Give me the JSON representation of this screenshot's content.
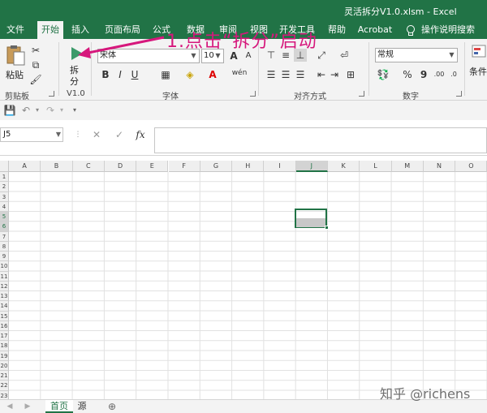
{
  "window": {
    "title": "灵活拆分V1.0.xlsm  -  Excel"
  },
  "tabs": [
    {
      "label": "文件"
    },
    {
      "label": "开始"
    },
    {
      "label": "插入"
    },
    {
      "label": "页面布局"
    },
    {
      "label": "公式"
    },
    {
      "label": "数据"
    },
    {
      "label": "审阅"
    },
    {
      "label": "视图"
    },
    {
      "label": "开发工具"
    },
    {
      "label": "帮助"
    },
    {
      "label": "Acrobat"
    }
  ],
  "tell_me": {
    "label": "操作说明搜索"
  },
  "ribbon": {
    "clipboard": {
      "paste_label": "粘贴",
      "group_label": "剪贴板"
    },
    "split": {
      "button_label_1": "拆",
      "button_label_2": "分",
      "group_label": "V1.0"
    },
    "font": {
      "family": "宋体",
      "size": "10",
      "grow": "A",
      "shrink": "A",
      "bold": "B",
      "italic": "I",
      "underline": "U",
      "font_color_letter": "A",
      "phonetic": "wén",
      "group_label": "字体"
    },
    "alignment": {
      "group_label": "对齐方式"
    },
    "number": {
      "format": "常规",
      "percent": "%",
      "comma": "9",
      "increase_decimal": ".00",
      "decrease_decimal": ".0",
      "group_label": "数字"
    },
    "styles": {
      "conditional_label": "条件"
    }
  },
  "formula_bar": {
    "name_box": "J5",
    "cancel": "✕",
    "enter": "✓",
    "fx": "fx",
    "value": ""
  },
  "grid": {
    "columns": [
      "A",
      "B",
      "C",
      "D",
      "E",
      "F",
      "G",
      "H",
      "I",
      "J",
      "K",
      "L",
      "M",
      "N",
      "O"
    ],
    "rows": [
      "1",
      "2",
      "3",
      "4",
      "5",
      "6",
      "7",
      "8",
      "9",
      "10",
      "11",
      "12",
      "13",
      "14",
      "15",
      "16",
      "17",
      "18",
      "19",
      "20",
      "21",
      "22",
      "23"
    ],
    "selected_column": "J",
    "selected_rows": [
      "5",
      "6"
    ]
  },
  "sheets": [
    {
      "label": "首页"
    },
    {
      "label": "源"
    }
  ],
  "annotation": {
    "text": "1.点击“拆分”启动",
    "color": "#d6177c"
  },
  "watermark": {
    "text": "知乎 @richens"
  },
  "colors": {
    "accent": "#217346",
    "annotation": "#d6177c"
  }
}
